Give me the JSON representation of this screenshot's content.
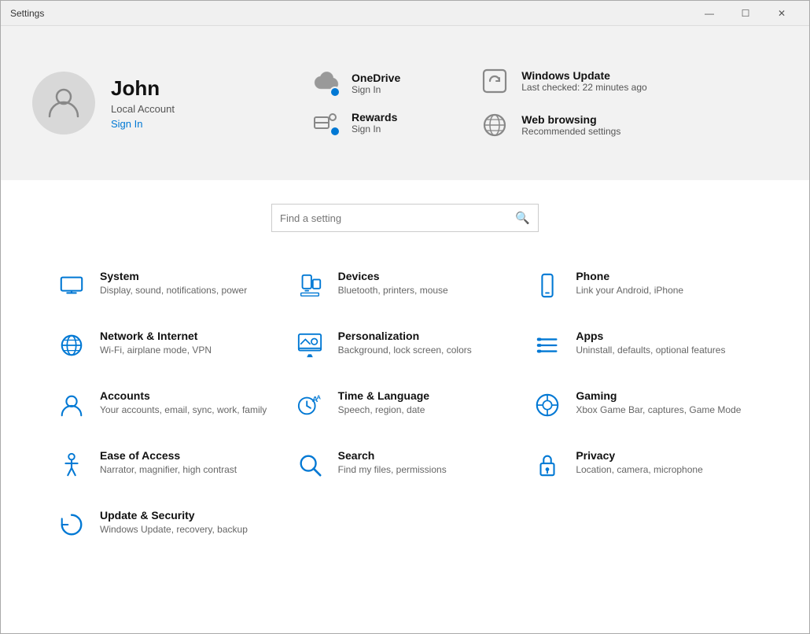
{
  "titleBar": {
    "title": "Settings",
    "minimize": "—",
    "maximize": "☐",
    "close": "✕"
  },
  "profile": {
    "name": "John",
    "accountType": "Local Account",
    "signInLabel": "Sign In"
  },
  "services": [
    {
      "id": "onedrive",
      "name": "OneDrive",
      "sub": "Sign In",
      "hasDot": true
    },
    {
      "id": "rewards",
      "name": "Rewards",
      "sub": "Sign In",
      "hasDot": true
    }
  ],
  "infoItems": [
    {
      "id": "windows-update",
      "name": "Windows Update",
      "sub": "Last checked: 22 minutes ago"
    },
    {
      "id": "web-browsing",
      "name": "Web browsing",
      "sub": "Recommended settings"
    }
  ],
  "search": {
    "placeholder": "Find a setting"
  },
  "settings": [
    {
      "id": "system",
      "name": "System",
      "desc": "Display, sound, notifications, power"
    },
    {
      "id": "devices",
      "name": "Devices",
      "desc": "Bluetooth, printers, mouse"
    },
    {
      "id": "phone",
      "name": "Phone",
      "desc": "Link your Android, iPhone"
    },
    {
      "id": "network",
      "name": "Network & Internet",
      "desc": "Wi-Fi, airplane mode, VPN"
    },
    {
      "id": "personalization",
      "name": "Personalization",
      "desc": "Background, lock screen, colors"
    },
    {
      "id": "apps",
      "name": "Apps",
      "desc": "Uninstall, defaults, optional features"
    },
    {
      "id": "accounts",
      "name": "Accounts",
      "desc": "Your accounts, email, sync, work, family"
    },
    {
      "id": "time-language",
      "name": "Time & Language",
      "desc": "Speech, region, date"
    },
    {
      "id": "gaming",
      "name": "Gaming",
      "desc": "Xbox Game Bar, captures, Game Mode"
    },
    {
      "id": "ease-of-access",
      "name": "Ease of Access",
      "desc": "Narrator, magnifier, high contrast"
    },
    {
      "id": "search",
      "name": "Search",
      "desc": "Find my files, permissions"
    },
    {
      "id": "privacy",
      "name": "Privacy",
      "desc": "Location, camera, microphone"
    },
    {
      "id": "update-security",
      "name": "Update & Security",
      "desc": "Windows Update, recovery, backup"
    }
  ]
}
